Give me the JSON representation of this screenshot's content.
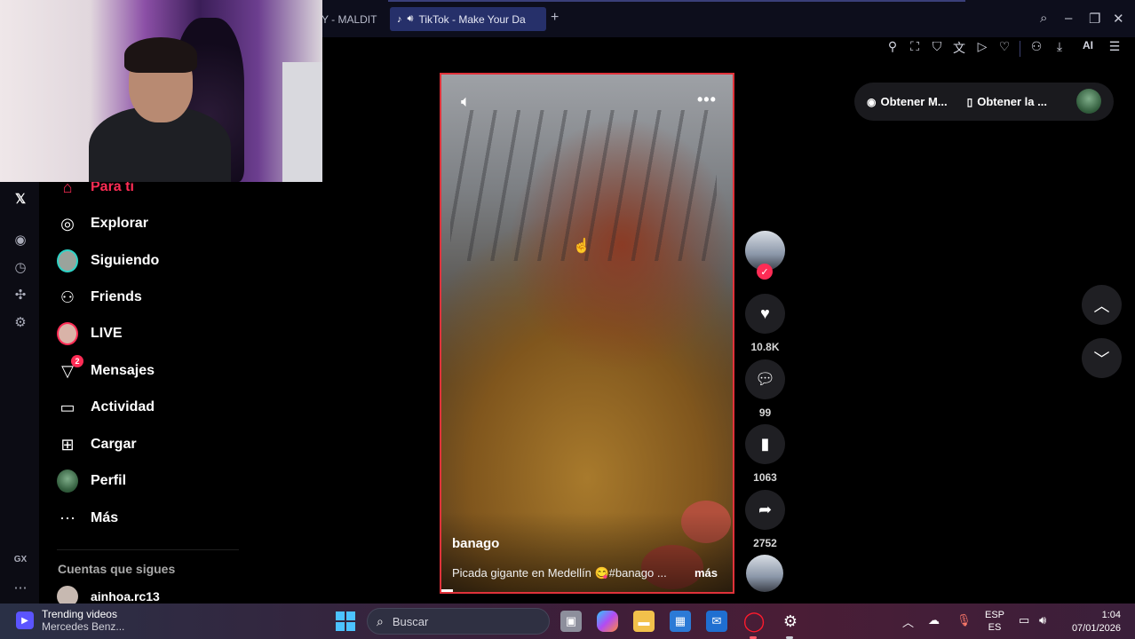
{
  "browser": {
    "tabs": [
      {
        "label": "Y - MALDIT",
        "active": false
      },
      {
        "label": "TikTok - Make Your Da",
        "active": true
      }
    ],
    "new_tab": "+",
    "toolbar_ai_label": "AI"
  },
  "sidebar": {
    "items": [
      {
        "label": "Para ti",
        "icon": "home-icon",
        "active": true
      },
      {
        "label": "Explorar",
        "icon": "compass-icon"
      },
      {
        "label": "Siguiendo",
        "icon": "following-avatar-icon"
      },
      {
        "label": "Friends",
        "icon": "friends-icon"
      },
      {
        "label": "LIVE",
        "icon": "live-avatar-icon"
      },
      {
        "label": "Mensajes",
        "icon": "messages-icon",
        "badge": "2"
      },
      {
        "label": "Actividad",
        "icon": "activity-icon"
      },
      {
        "label": "Cargar",
        "icon": "upload-icon"
      },
      {
        "label": "Perfil",
        "icon": "profile-avatar-icon"
      },
      {
        "label": "Más",
        "icon": "more-icon"
      }
    ],
    "following_title": "Cuentas que sigues",
    "following_user": "ainhoa.rc13"
  },
  "video": {
    "author": "banago",
    "caption": "Picada gigante en Medellín 😋#banago ...",
    "more": "más",
    "more_icon": "•••"
  },
  "actions": {
    "likes": "10.8K",
    "comments": "99",
    "saves": "1063",
    "shares": "2752"
  },
  "get_pill": {
    "item1": "Obtener M...",
    "item2": "Obtener la ..."
  },
  "taskbar": {
    "weather_title": "Trending videos",
    "weather_sub": "Mercedes Benz...",
    "search_placeholder": "Buscar",
    "lang_top": "ESP",
    "lang_bottom": "ES",
    "time": "1:04",
    "date": "07/01/2026"
  },
  "colors": {
    "accent": "#fe2c55",
    "video_border": "#e0323a",
    "active_tab": "#26306a"
  }
}
